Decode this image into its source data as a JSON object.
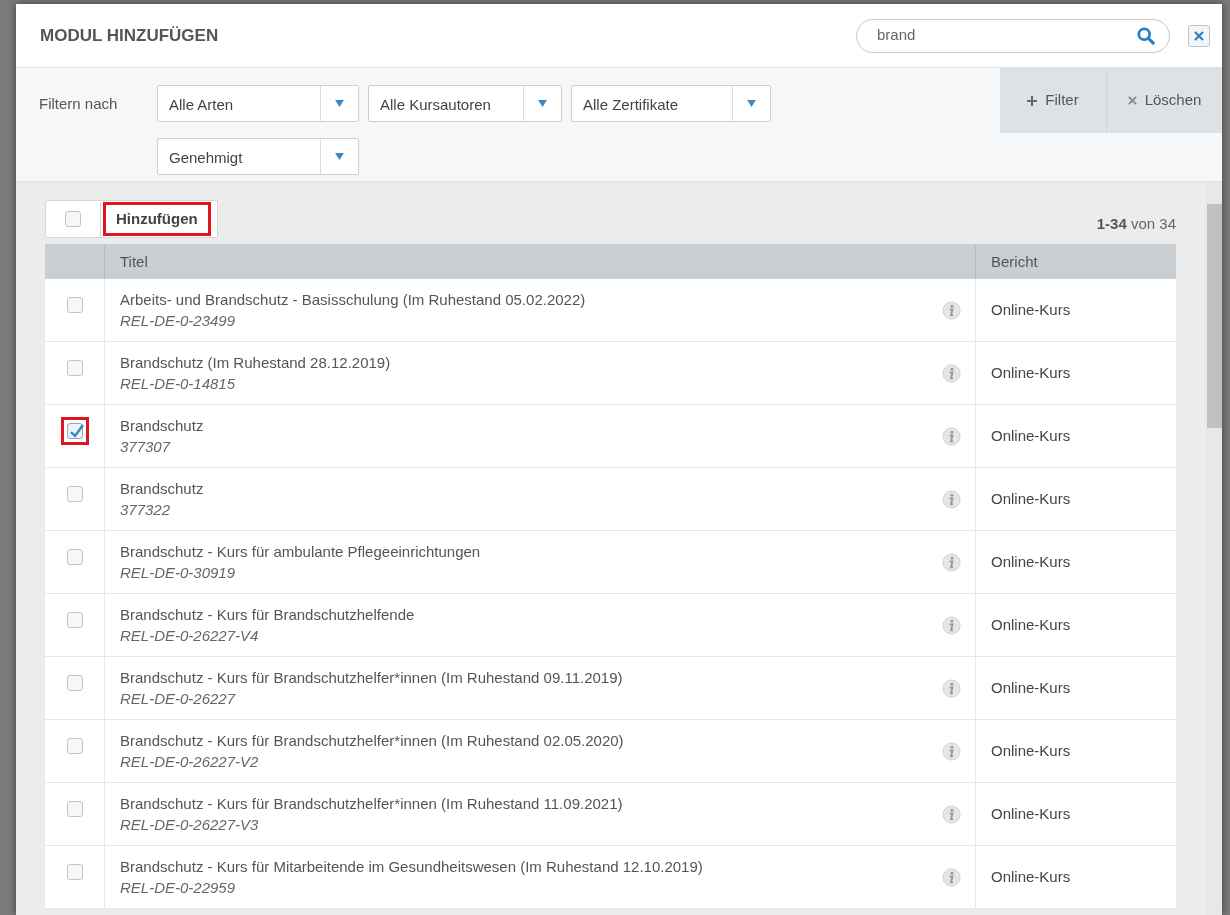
{
  "dialog": {
    "title": "MODUL HINZUFÜGEN",
    "search": {
      "value": "brand"
    }
  },
  "filters": {
    "label": "Filtern nach",
    "selects": [
      {
        "value": "Alle Arten"
      },
      {
        "value": "Alle Kursautoren"
      },
      {
        "value": "Alle Zertifikate"
      },
      {
        "value": "Genehmigt"
      }
    ],
    "filter_button": "Filter",
    "clear_button": "Löschen"
  },
  "toolbar": {
    "select_all": {
      "checked": false
    },
    "add_button": {
      "label": "Hinzufügen",
      "highlighted": true
    },
    "count_bold": "1-34",
    "count_rest": "von 34"
  },
  "table": {
    "columns": [
      "Titel",
      "Bericht"
    ],
    "rows": [
      {
        "title": "Arbeits- und Brandschutz - Basisschulung (Im Ruhestand 05.02.2022)",
        "code": "REL-DE-0-23499",
        "report": "Online-Kurs",
        "checked": false,
        "highlighted": false
      },
      {
        "title": "Brandschutz (Im Ruhestand 28.12.2019)",
        "code": "REL-DE-0-14815",
        "report": "Online-Kurs",
        "checked": false,
        "highlighted": false
      },
      {
        "title": "Brandschutz",
        "code": "377307",
        "report": "Online-Kurs",
        "checked": true,
        "highlighted": true
      },
      {
        "title": "Brandschutz",
        "code": "377322",
        "report": "Online-Kurs",
        "checked": false,
        "highlighted": false
      },
      {
        "title": "Brandschutz - Kurs für ambulante Pflegeeinrichtungen",
        "code": "REL-DE-0-30919",
        "report": "Online-Kurs",
        "checked": false,
        "highlighted": false
      },
      {
        "title": "Brandschutz - Kurs für Brandschutzhelfende",
        "code": "REL-DE-0-26227-V4",
        "report": "Online-Kurs",
        "checked": false,
        "highlighted": false
      },
      {
        "title": "Brandschutz - Kurs für Brandschutzhelfer*innen (Im Ruhestand 09.11.2019)",
        "code": "REL-DE-0-26227",
        "report": "Online-Kurs",
        "checked": false,
        "highlighted": false
      },
      {
        "title": "Brandschutz - Kurs für Brandschutzhelfer*innen (Im Ruhestand 02.05.2020)",
        "code": "REL-DE-0-26227-V2",
        "report": "Online-Kurs",
        "checked": false,
        "highlighted": false
      },
      {
        "title": "Brandschutz - Kurs für Brandschutzhelfer*innen (Im Ruhestand 11.09.2021)",
        "code": "REL-DE-0-26227-V3",
        "report": "Online-Kurs",
        "checked": false,
        "highlighted": false
      },
      {
        "title": "Brandschutz - Kurs für Mitarbeitende im Gesundheitswesen (Im Ruhestand 12.10.2019)",
        "code": "REL-DE-0-22959",
        "report": "Online-Kurs",
        "checked": false,
        "highlighted": false
      }
    ]
  }
}
